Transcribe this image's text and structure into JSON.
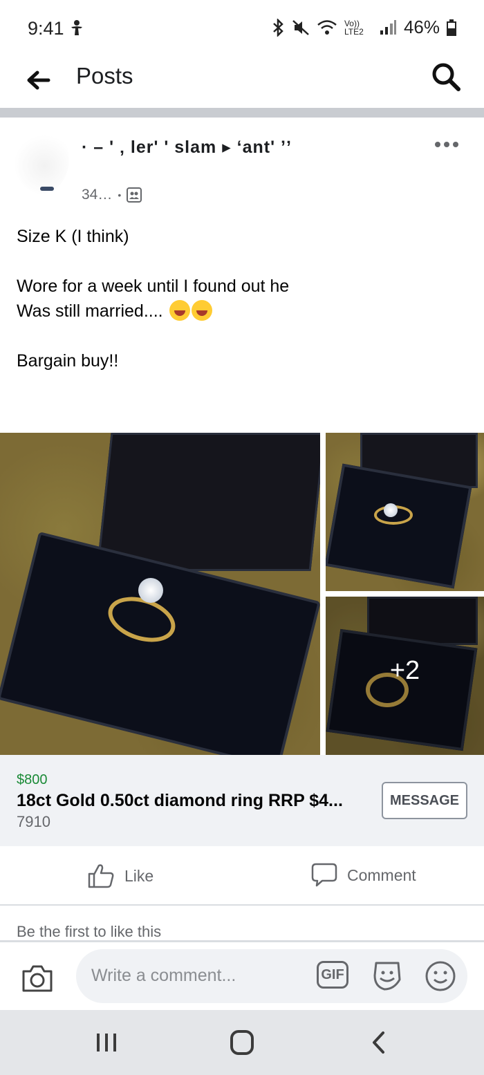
{
  "status_bar": {
    "time": "9:41",
    "network": "Vo)) LTE2",
    "battery": "46%"
  },
  "header": {
    "title": "Posts"
  },
  "post": {
    "author_line": "· – ' ‚ ler' ' slam ▸ ‘ant' ’ʼ",
    "meta": "34…",
    "text_lines": [
      "Size K (I think)",
      "Wore for a week until I found out he",
      "Was still married....",
      "Bargain buy!!"
    ],
    "more_photos_label": "+2"
  },
  "listing": {
    "price": "$800",
    "title": "18ct Gold 0.50ct diamond ring RRP $4...",
    "code": "7910",
    "message_label": "MESSAGE"
  },
  "actions": {
    "like_label": "Like",
    "comment_label": "Comment"
  },
  "likes_summary": "Be the first to like this",
  "composer": {
    "placeholder": "Write a comment...",
    "gif_label": "GIF"
  },
  "icons": {
    "back": "back-arrow-icon",
    "search": "search-icon",
    "more": "more-options-icon",
    "like": "thumbs-up-icon",
    "comment": "speech-bubble-icon",
    "camera": "camera-icon",
    "sticker": "sticker-icon",
    "emoji": "smiley-icon"
  },
  "colors": {
    "price_green": "#1a8a36",
    "divider_gray": "#c9ccd1",
    "muted_text": "#65676b"
  }
}
